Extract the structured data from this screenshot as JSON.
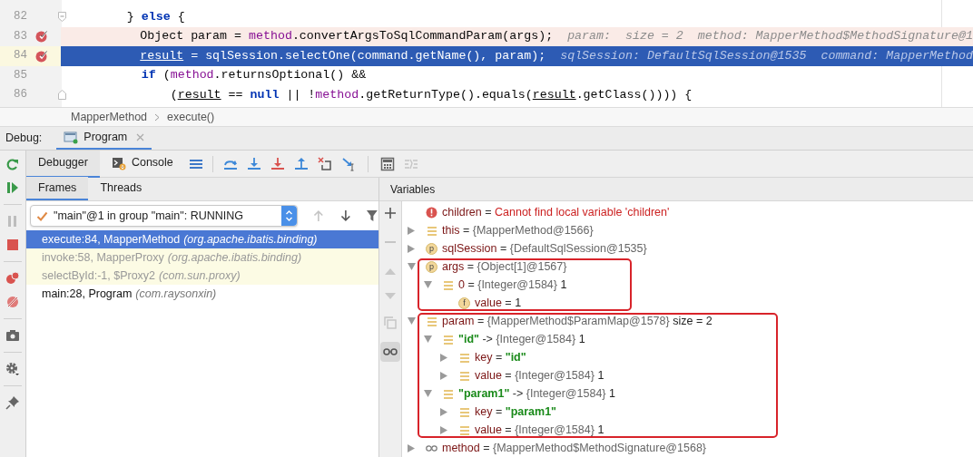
{
  "editor": {
    "lines": [
      {
        "number": "82",
        "fold_start": true,
        "breakpoint": false,
        "current": false,
        "tokens": [
          {
            "t": "         } ",
            "kind": "plain"
          },
          {
            "t": "else",
            "kind": "keyword"
          },
          {
            "t": " {",
            "kind": "plain"
          }
        ]
      },
      {
        "number": "83",
        "breakpoint": true,
        "current": false,
        "tokens": [
          {
            "t": "           Object param = ",
            "kind": "plain"
          },
          {
            "t": "method",
            "kind": "field"
          },
          {
            "t": ".convertArgsToSqlCommandParam(args);",
            "kind": "plain"
          }
        ],
        "hint": "param:  size = 2  method: MapperMethod$MethodSignature@1"
      },
      {
        "number": "84",
        "breakpoint": true,
        "current": true,
        "tokens": [
          {
            "t": "           result",
            "kind": "var"
          },
          {
            "t": " = sqlSession.selectOne(command.getName(), param);",
            "kind": "plain"
          }
        ],
        "hint": "sqlSession: DefaultSqlSession@1535  command: MapperMethod"
      },
      {
        "number": "85",
        "breakpoint": false,
        "current": false,
        "tokens": [
          {
            "t": "           if",
            "kind": "keyword"
          },
          {
            "t": " (",
            "kind": "plain"
          },
          {
            "t": "method",
            "kind": "field"
          },
          {
            "t": ".returnsOptional() &&",
            "kind": "plain"
          }
        ]
      },
      {
        "number": "86",
        "fold_end": true,
        "breakpoint": false,
        "current": false,
        "tokens": [
          {
            "t": "               (",
            "kind": "plain"
          },
          {
            "t": "result",
            "kind": "var"
          },
          {
            "t": " == ",
            "kind": "plain"
          },
          {
            "t": "null",
            "kind": "keyword"
          },
          {
            "t": " || !",
            "kind": "plain"
          },
          {
            "t": "method",
            "kind": "field"
          },
          {
            "t": ".getReturnType().equals(",
            "kind": "plain"
          },
          {
            "t": "result",
            "kind": "var"
          },
          {
            "t": ".getClass()))) {",
            "kind": "plain"
          }
        ]
      }
    ],
    "breadcrumbs": [
      "MapperMethod",
      "execute()"
    ]
  },
  "debug": {
    "label": "Debug:",
    "session_tab": "Program",
    "tabs": [
      {
        "label": "Debugger",
        "selected": true
      },
      {
        "label": "Console",
        "selected": false
      }
    ]
  },
  "frames_panel": {
    "tabs": [
      {
        "label": "Frames",
        "selected": true
      },
      {
        "label": "Threads",
        "selected": false
      }
    ],
    "thread": "\"main\"@1 in group \"main\": RUNNING",
    "frames": [
      {
        "label": "execute:84, MapperMethod",
        "package": "(org.apache.ibatis.binding)",
        "selected": true,
        "library": false
      },
      {
        "label": "invoke:58, MapperProxy",
        "package": "(org.apache.ibatis.binding)",
        "selected": false,
        "library": true
      },
      {
        "label": "selectById:-1, $Proxy2",
        "package": "(com.sun.proxy)",
        "selected": false,
        "library": true
      },
      {
        "label": "main:28, Program",
        "package": "(com.raysonxin)",
        "selected": false,
        "library": false
      }
    ]
  },
  "variables": {
    "title": "Variables",
    "watches_shown": true,
    "items": [
      {
        "kind": "error",
        "name": "children",
        "separator": "=",
        "value": {
          "t": "Cannot find local variable 'children'",
          "kind": "error"
        }
      },
      {
        "kind": "object",
        "name": "this",
        "separator": "=",
        "value": "{MapperMethod@1566}",
        "expanded": false
      },
      {
        "kind": "parameter",
        "badge": "p",
        "name": "sqlSession",
        "separator": "=",
        "value": "{DefaultSqlSession@1535}",
        "expanded": false
      },
      {
        "kind": "parameter",
        "badge": "p",
        "name": "args",
        "separator": "=",
        "value": "{Object[1]@1567}",
        "expanded": true,
        "boxed": true,
        "children": [
          {
            "kind": "object",
            "name": "0",
            "separator": "=",
            "value": "{Integer@1584}",
            "detail": "1",
            "expanded": true,
            "children": [
              {
                "kind": "field",
                "badge": "f",
                "name": "value",
                "separator": "=",
                "value": {
                  "t": "1",
                  "kind": "number"
                }
              }
            ]
          }
        ]
      },
      {
        "kind": "object",
        "name": "param",
        "separator": "=",
        "value": "{MapperMethod$ParamMap@1578}",
        "detail": "size = 2",
        "expanded": true,
        "boxed": true,
        "children": [
          {
            "kind": "object",
            "name": {
              "t": "\"id\"",
              "kind": "string"
            },
            "separator": "->",
            "value": "{Integer@1584}",
            "detail": "1",
            "expanded": true,
            "children": [
              {
                "kind": "object",
                "name": "key",
                "separator": "=",
                "value": {
                  "t": "\"id\"",
                  "kind": "string"
                },
                "expanded": false
              },
              {
                "kind": "object",
                "name": "value",
                "separator": "=",
                "value": "{Integer@1584}",
                "detail": "1",
                "expanded": false
              }
            ]
          },
          {
            "kind": "object",
            "name": {
              "t": "\"param1\"",
              "kind": "string"
            },
            "separator": "->",
            "value": "{Integer@1584}",
            "detail": "1",
            "expanded": true,
            "children": [
              {
                "kind": "object",
                "name": "key",
                "separator": "=",
                "value": {
                  "t": "\"param1\"",
                  "kind": "string"
                },
                "expanded": false
              },
              {
                "kind": "object",
                "name": "value",
                "separator": "=",
                "value": "{Integer@1584}",
                "detail": "1",
                "expanded": false
              }
            ]
          }
        ]
      },
      {
        "kind": "watch",
        "name": "method",
        "separator": "=",
        "value": "{MapperMethod$MethodSignature@1568}",
        "expanded": false
      }
    ]
  }
}
